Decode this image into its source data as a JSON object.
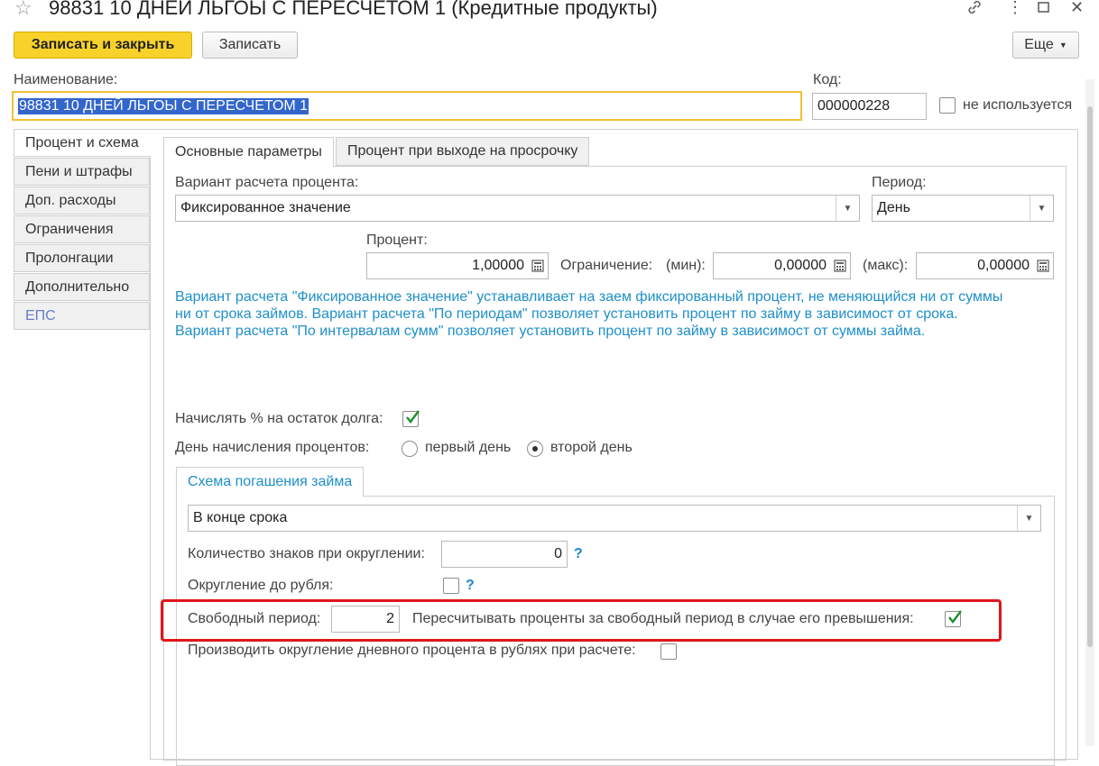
{
  "window": {
    "title": "98831 10 ДНЕЙ ЛЬГОЫ С ПЕРЕСЧЕТОМ 1 (Кредитные продукты)"
  },
  "toolbar": {
    "save_close_label": "Записать и закрыть",
    "save_label": "Записать",
    "more_label": "Еще"
  },
  "header": {
    "name_label": "Наименование:",
    "name_value": "98831 10 ДНЕЙ ЛЬГОЫ С ПЕРЕСЧЕТОМ 1",
    "code_label": "Код:",
    "code_value": "000000228",
    "not_used_label": "не используется",
    "not_used_checked": false
  },
  "side_tabs": [
    {
      "label": "Процент и схема",
      "active": true
    },
    {
      "label": "Пени и штрафы"
    },
    {
      "label": "Доп. расходы"
    },
    {
      "label": "Ограничения"
    },
    {
      "label": "Пролонгации"
    },
    {
      "label": "Дополнительно"
    },
    {
      "label": "ЕПС"
    }
  ],
  "top_tabs": [
    {
      "label": "Основные параметры",
      "active": true
    },
    {
      "label": "Процент при выходе на просрочку"
    }
  ],
  "main": {
    "calc_variant_label": "Вариант расчета процента:",
    "calc_variant_value": "Фиксированное значение",
    "period_label": "Период:",
    "period_value": "День",
    "percent_label": "Процент:",
    "percent_value": "1,00000",
    "limit_label": "Ограничение:",
    "min_label": "(мин):",
    "min_value": "0,00000",
    "max_label": "(макс):",
    "max_value": "0,00000",
    "info_lines": [
      "Вариант расчета \"Фиксированное значение\" устанавливает на заем фиксированный процент, не меняющийся ни от суммы",
      "ни от срока займов. Вариант расчета \"По периодам\" позволяет установить процент по займу в зависимост от срока.",
      "Вариант расчета \"По интервалам сумм\" позволяет установить процент по займу в зависимост от суммы займа."
    ],
    "accrue_balance_label": "Начислять % на остаток долга:",
    "accrue_balance_checked": true,
    "accrual_day_label": "День начисления процентов:",
    "radio_first": "первый день",
    "radio_second": "второй день",
    "radio_selected": "второй день"
  },
  "scheme": {
    "tab_label": "Схема погашения займа",
    "scheme_value": "В конце срока",
    "rounding_digits_label": "Количество знаков при округлении:",
    "rounding_digits_value": "0",
    "round_ruble_label": "Округление до рубля:",
    "round_ruble_checked": false,
    "help_mark": "?",
    "grace_period_label": "Свободный период:",
    "grace_period_value": "2",
    "recalc_label": "Пересчитывать проценты за свободный период в случае его превышения:",
    "recalc_checked": true,
    "daily_round_label": "Производить округление дневного процента в рублях при расчете:",
    "daily_round_checked": false
  },
  "colors": {
    "primary_button": "#f8d22a",
    "info_text": "#1e8fc8",
    "highlight_box": "#e0151b",
    "check_mark": "#1f8f2f"
  }
}
